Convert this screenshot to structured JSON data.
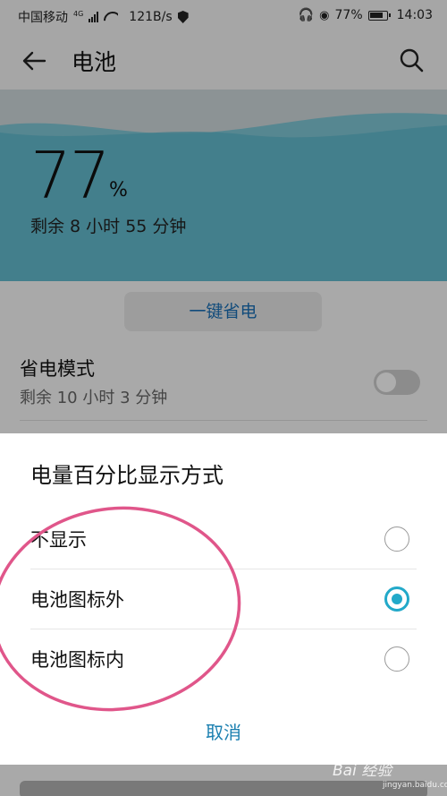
{
  "status_bar": {
    "carrier": "中国移动",
    "network": "4G",
    "speed": "121B/s",
    "battery": "77%",
    "time": "14:03"
  },
  "app_bar": {
    "title": "电池",
    "back_icon": "arrow-left-icon",
    "search_icon": "search-icon"
  },
  "battery_card": {
    "percent": "77",
    "unit": "%",
    "remaining": "剩余 8 小时 55 分钟"
  },
  "one_key_save": "一键省电",
  "power_saving": {
    "title": "省电模式",
    "subtitle": "剩余 10 小时 3 分钟",
    "enabled": false
  },
  "dialog": {
    "title": "电量百分比显示方式",
    "options": [
      {
        "label": "不显示",
        "selected": false
      },
      {
        "label": "电池图标外",
        "selected": true
      },
      {
        "label": "电池图标内",
        "selected": false
      }
    ],
    "cancel": "取消"
  },
  "colors": {
    "accent": "#22a9c9",
    "link": "#1a7fb0",
    "annotation": "#e0568a",
    "wave": "#5fb8cc"
  },
  "watermark": {
    "brand": "Bai 经验",
    "url": "jingyan.baidu.com"
  }
}
